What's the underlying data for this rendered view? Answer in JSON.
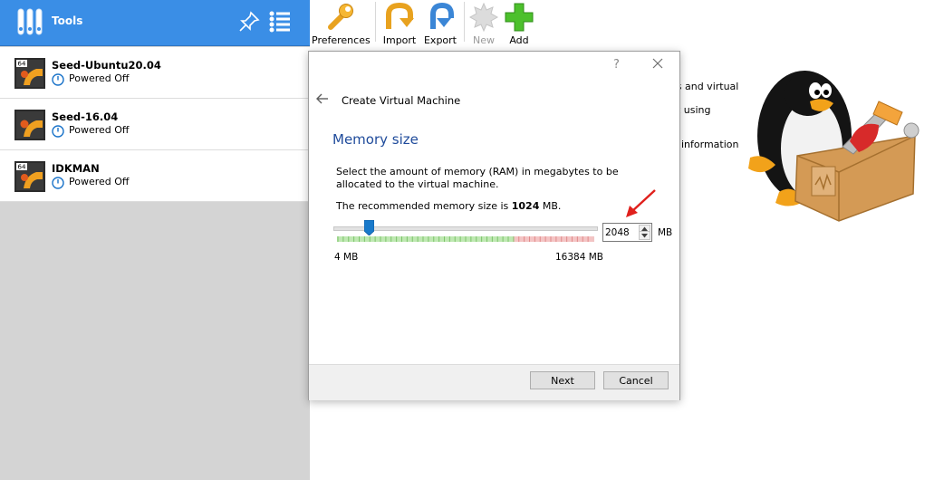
{
  "sidebar": {
    "tools_label": "Tools",
    "vms": [
      {
        "name": "Seed-Ubuntu20.04",
        "state": "Powered Off",
        "os_icon": "ubuntu-64-icon"
      },
      {
        "name": "Seed-16.04",
        "state": "Powered Off",
        "os_icon": "ubuntu-icon"
      },
      {
        "name": "IDKMAN",
        "state": "Powered Off",
        "os_icon": "ubuntu-64-icon"
      }
    ]
  },
  "toolbar": {
    "preferences": "Preferences",
    "import": "Import",
    "export": "Export",
    "new": "New",
    "add": "Add"
  },
  "welcome": {
    "fragments": [
      "es and virtual",
      "nt using",
      "information"
    ]
  },
  "dialog": {
    "help": "?",
    "title": "Create Virtual Machine",
    "heading": "Memory size",
    "description": "Select the amount of memory (RAM) in megabytes to be allocated to the virtual machine.",
    "recommended_prefix": "The recommended memory size is ",
    "recommended_value": "1024",
    "recommended_suffix": " MB.",
    "memory": {
      "value": "2048",
      "unit": "MB",
      "min_label": "4 MB",
      "max_label": "16384 MB",
      "min": 4,
      "max": 16384,
      "slider_value": 2048
    },
    "next_label": "Next",
    "cancel_label": "Cancel"
  },
  "colors": {
    "header_blue": "#3a8ee6",
    "heading_blue": "#1f4b9b",
    "slider_handle": "#1979ca",
    "arrow_red": "#e0201c"
  }
}
